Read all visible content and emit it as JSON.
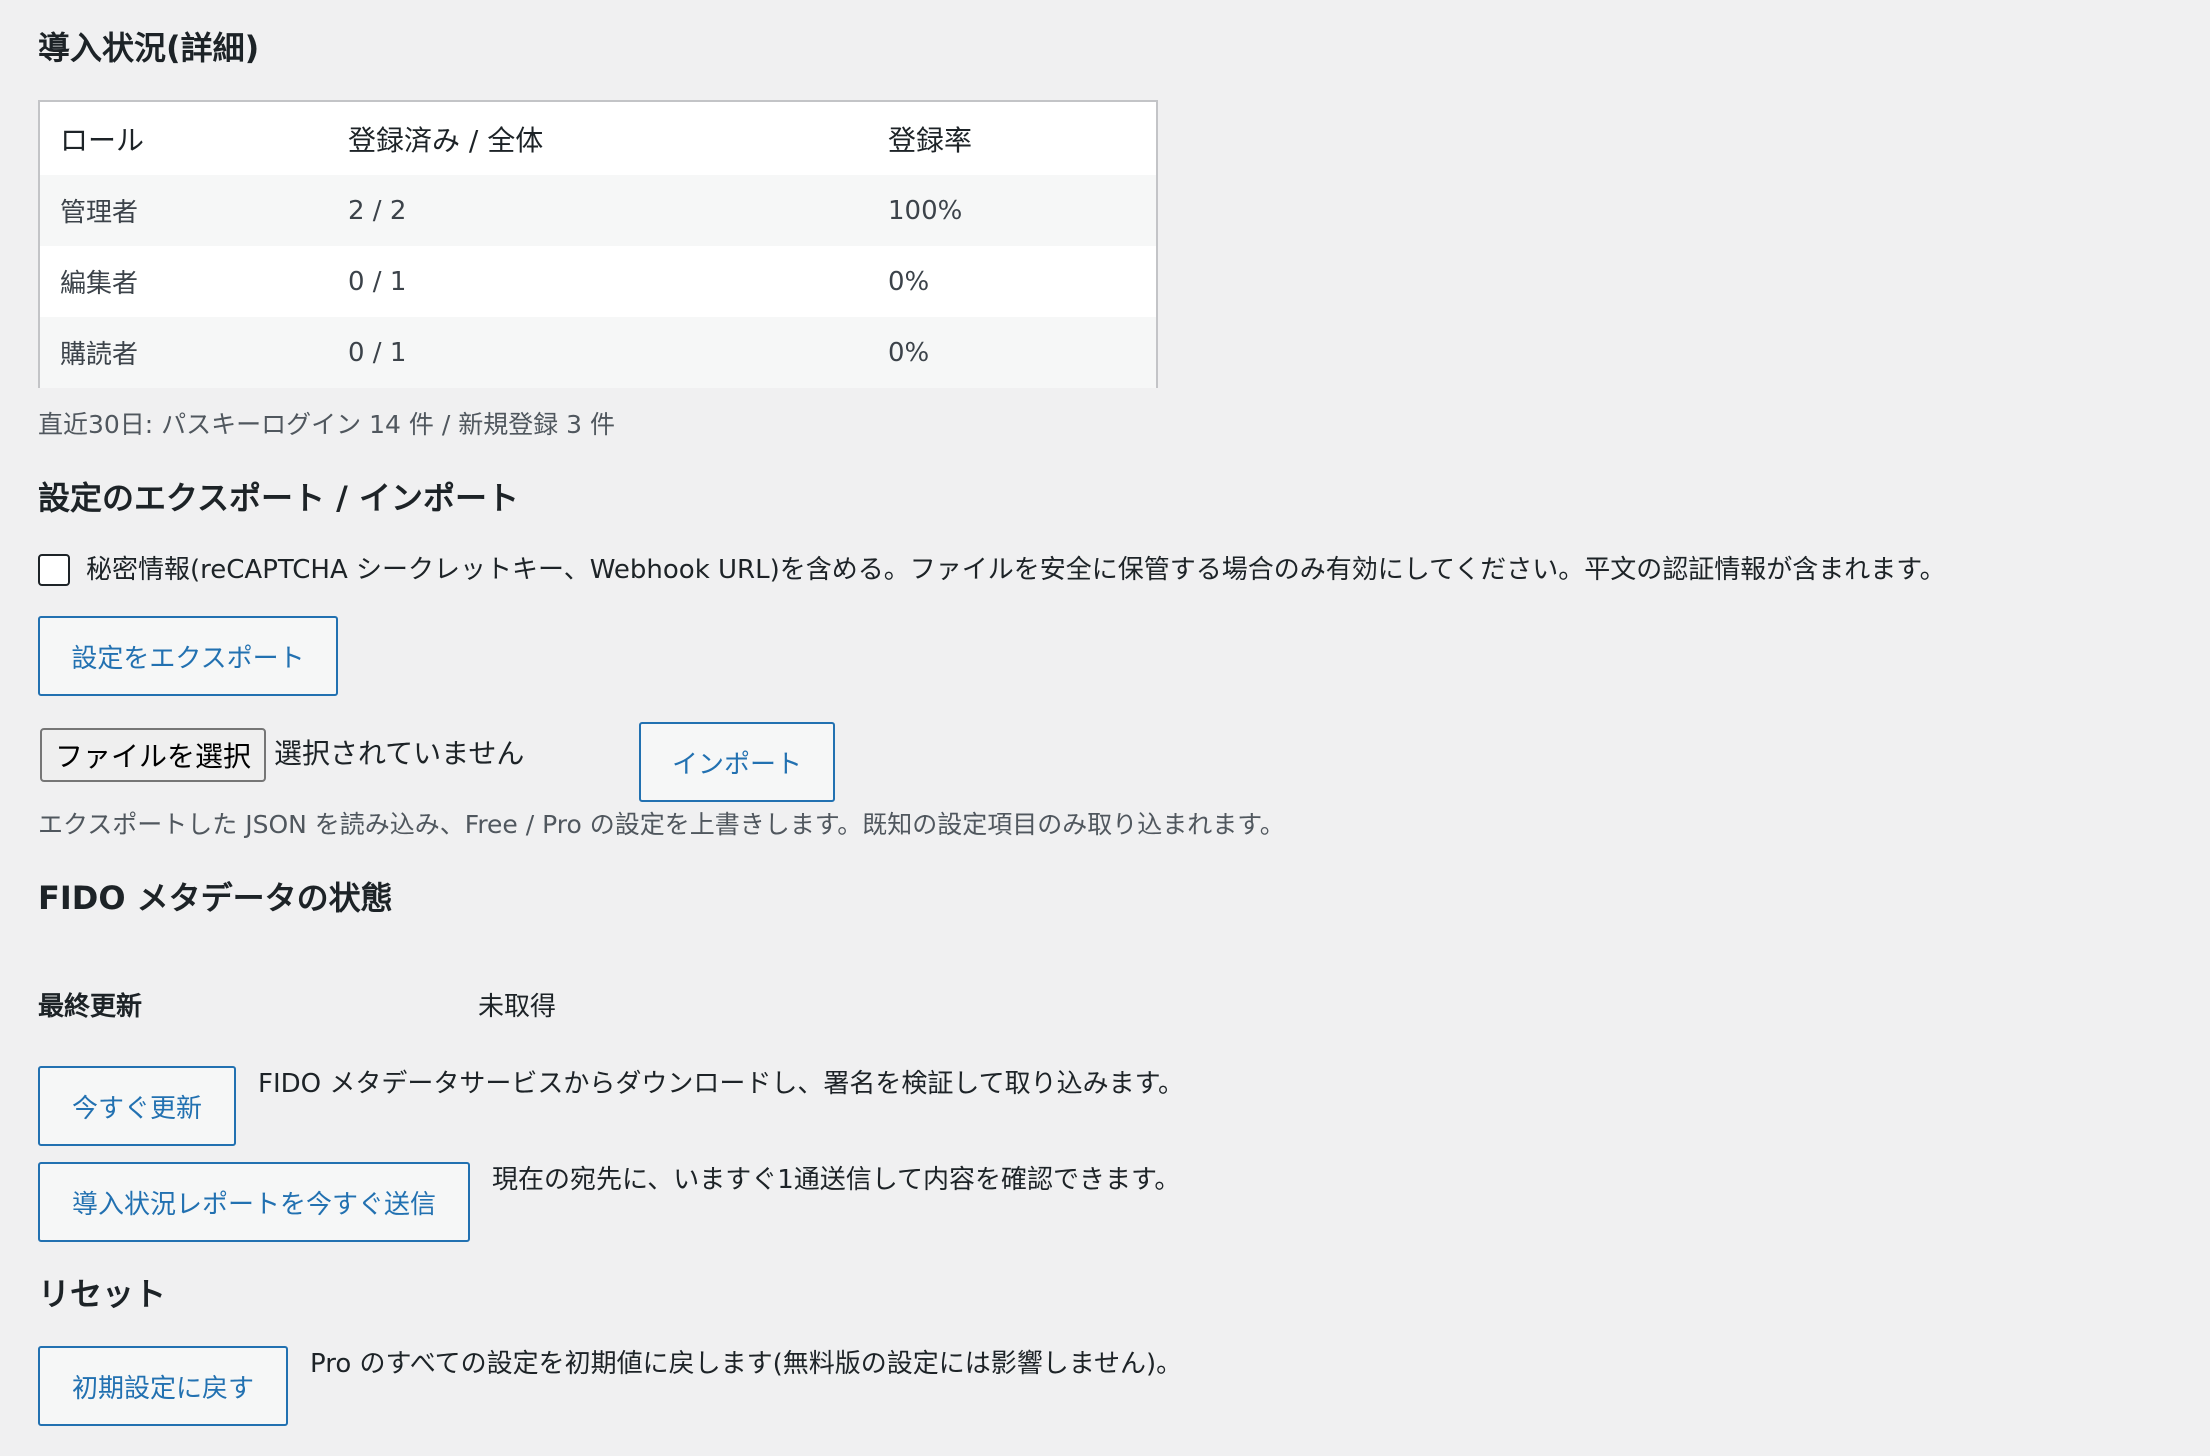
{
  "details": {
    "title": "導入状況(詳細)",
    "table": {
      "headers": [
        "ロール",
        "登録済み / 全体",
        "登録率"
      ],
      "rows": [
        {
          "role": "管理者",
          "ratio": "2 / 2",
          "rate": "100%"
        },
        {
          "role": "編集者",
          "ratio": "0 / 1",
          "rate": "0%"
        },
        {
          "role": "購読者",
          "ratio": "0 / 1",
          "rate": "0%"
        }
      ]
    },
    "summary": "直近30日: パスキーログイン 14 件 / 新規登録 3 件"
  },
  "export_import": {
    "title": "設定のエクスポート / インポート",
    "include_secrets_label": "秘密情報(reCAPTCHA シークレットキー、Webhook URL)を含める。ファイルを安全に保管する場合のみ有効にしてください。平文の認証情報が含まれます。",
    "include_secrets_checked": false,
    "export_button": "設定をエクスポート",
    "file_button": "ファイルを選択",
    "file_status": "選択されていません",
    "import_button": "インポート",
    "note": "エクスポートした JSON を読み込み、Free / Pro の設定を上書きします。既知の設定項目のみ取り込まれます。"
  },
  "fido": {
    "title": "FIDO メタデータの状態",
    "last_updated_label": "最終更新",
    "last_updated_value": "未取得",
    "update_button": "今すぐ更新",
    "update_desc": "FIDO メタデータサービスからダウンロードし、署名を検証して取り込みます。",
    "report_button": "導入状況レポートを今すぐ送信",
    "report_desc": "現在の宛先に、いますぐ1通送信して内容を確認できます。"
  },
  "reset": {
    "title": "リセット",
    "reset_button": "初期設定に戻す",
    "reset_desc": "Pro のすべての設定を初期値に戻します(無料版の設定には影響しません)。"
  }
}
